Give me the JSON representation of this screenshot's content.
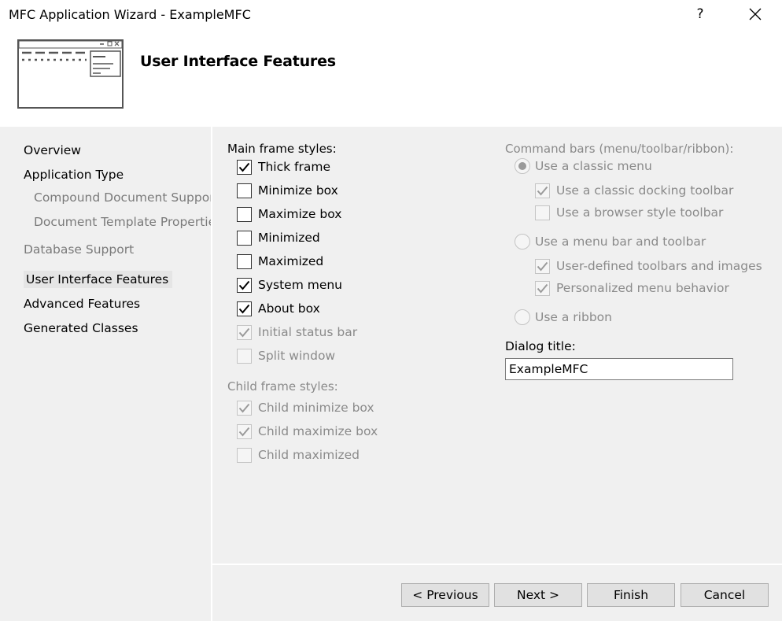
{
  "window": {
    "title": "MFC Application Wizard - ExampleMFC",
    "help_glyph": "?"
  },
  "header": {
    "heading": "User Interface Features"
  },
  "nav": {
    "items": [
      {
        "label": "Overview",
        "state": "normal"
      },
      {
        "label": "Application Type",
        "state": "normal"
      },
      {
        "label": "Compound Document Support",
        "state": "disabled"
      },
      {
        "label": "Document Template Properties",
        "state": "disabled"
      },
      {
        "label": "Database Support",
        "state": "disabled"
      },
      {
        "label": "User Interface Features",
        "state": "selected"
      },
      {
        "label": "Advanced Features",
        "state": "normal"
      },
      {
        "label": "Generated Classes",
        "state": "normal"
      }
    ]
  },
  "main_frame": {
    "label": "Main frame styles:",
    "options": [
      {
        "label": "Thick frame",
        "checked": true,
        "enabled": true
      },
      {
        "label": "Minimize box",
        "checked": false,
        "enabled": true
      },
      {
        "label": "Maximize box",
        "checked": false,
        "enabled": true
      },
      {
        "label": "Minimized",
        "checked": false,
        "enabled": true
      },
      {
        "label": "Maximized",
        "checked": false,
        "enabled": true
      },
      {
        "label": "System menu",
        "checked": true,
        "enabled": true
      },
      {
        "label": "About box",
        "checked": true,
        "enabled": true
      },
      {
        "label": "Initial status bar",
        "checked": true,
        "enabled": false
      },
      {
        "label": "Split window",
        "checked": false,
        "enabled": false
      }
    ]
  },
  "child_frame": {
    "label": "Child frame styles:",
    "options": [
      {
        "label": "Child minimize box",
        "checked": true,
        "enabled": false
      },
      {
        "label": "Child maximize box",
        "checked": true,
        "enabled": false
      },
      {
        "label": "Child maximized",
        "checked": false,
        "enabled": false
      }
    ]
  },
  "command_bars": {
    "label": "Command bars (menu/toolbar/ribbon):",
    "classic_menu": {
      "label": "Use a classic menu",
      "selected": true
    },
    "classic_docking": {
      "label": "Use a classic docking toolbar",
      "checked": true
    },
    "browser_style": {
      "label": "Use a browser style toolbar",
      "checked": false
    },
    "menu_bar": {
      "label": "Use a menu bar and toolbar",
      "selected": false
    },
    "user_defined": {
      "label": "User-defined toolbars and images",
      "checked": true
    },
    "personalized": {
      "label": "Personalized menu behavior",
      "checked": true
    },
    "ribbon": {
      "label": "Use a ribbon",
      "selected": false
    }
  },
  "dialog_title": {
    "label": "Dialog title:",
    "value": "ExampleMFC"
  },
  "buttons": {
    "previous": "< Previous",
    "next": "Next >",
    "finish": "Finish",
    "cancel": "Cancel"
  },
  "colors": {
    "panel": "#f0f0f0",
    "white": "#ffffff",
    "disabled_text": "#8a8a8a",
    "button_face": "#e1e1e1"
  }
}
